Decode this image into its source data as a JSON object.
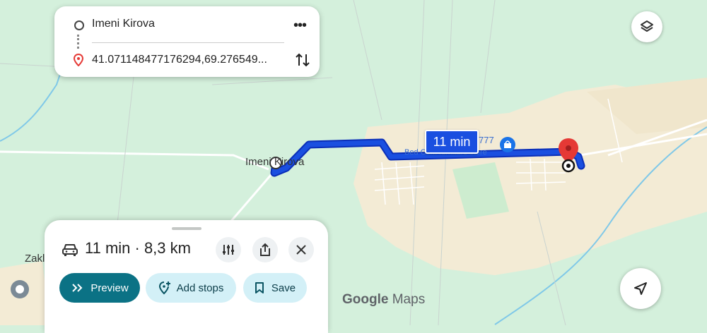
{
  "directions": {
    "origin": "Imeni Kirova",
    "destination": "41.071148477176294,69.276549..."
  },
  "map": {
    "place_label_village": "Imeni Kirova",
    "route_badge": "11 min",
    "shop_label": "Bed Com furniture store",
    "shop_number": "777",
    "edge_label_left": "Zakl",
    "watermark_brand": "Google",
    "watermark_product": "Maps"
  },
  "trip": {
    "summary": "11 min · 8,3 km",
    "mode_icon": "car-icon"
  },
  "actions": {
    "preview_label": "Preview",
    "add_stops_label": "Add stops",
    "save_label": "Save"
  },
  "colors": {
    "route": "#1a4fe0",
    "route_outline": "#0b2fb8",
    "accent_teal": "#0b7285",
    "chip_bg": "#d3f0f7",
    "pin_red": "#e53935",
    "shop_blue": "#1a73e8",
    "land_green": "#d4f0dc",
    "land_sand": "#f3ebd5"
  }
}
